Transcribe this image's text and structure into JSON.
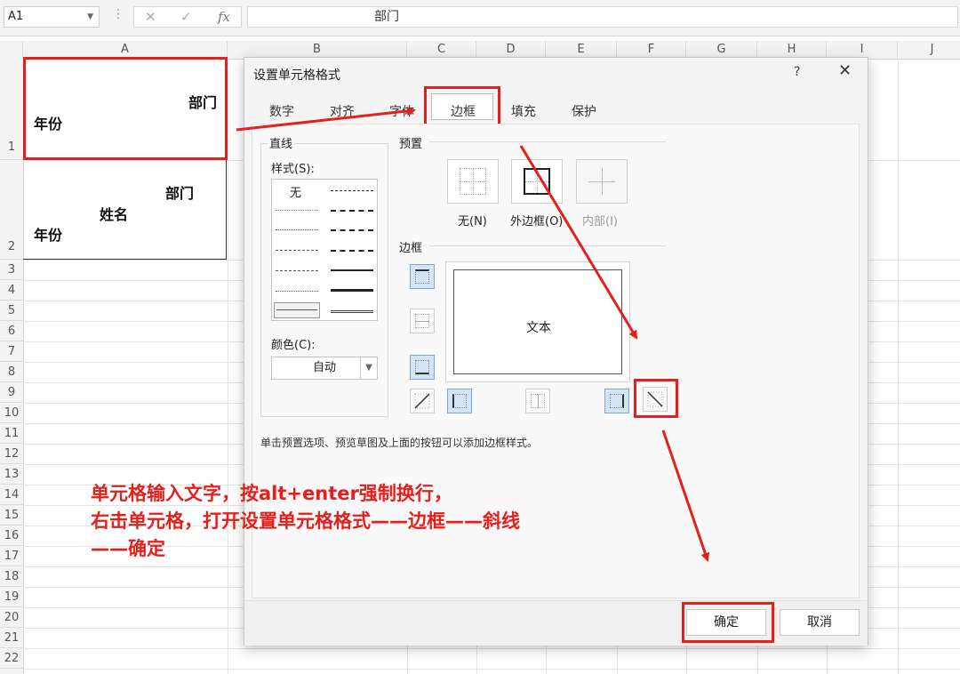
{
  "formula_bar": {
    "name_box": "A1",
    "formula": "部门",
    "cancel_icon": "✕",
    "enter_icon": "✓",
    "fx_icon": "fx"
  },
  "grid": {
    "columns": [
      "A",
      "B",
      "C",
      "D",
      "E",
      "F",
      "G",
      "H",
      "I",
      "J"
    ],
    "rows": [
      "1",
      "2",
      "3",
      "4",
      "5",
      "6",
      "7",
      "8",
      "9",
      "10",
      "11",
      "12",
      "13",
      "14",
      "15",
      "16",
      "17",
      "18",
      "19",
      "20",
      "21",
      "22"
    ],
    "a1": {
      "line1": "部门",
      "line2": "年份"
    },
    "a2": {
      "line1": "部门",
      "line2": "姓名",
      "line3": "年份"
    }
  },
  "dialog": {
    "title": "设置单元格格式",
    "help": "?",
    "close": "✕",
    "tabs": [
      "数字",
      "对齐",
      "字体",
      "边框",
      "填充",
      "保护"
    ],
    "active_tab": "边框",
    "line": {
      "group_label": "直线",
      "style_label": "样式(S):",
      "none_label": "无",
      "color_label": "颜色(C):",
      "color_value": "自动"
    },
    "presets": {
      "label": "预置",
      "none": "无(N)",
      "outline": "外边框(O)",
      "inside": "内部(I)"
    },
    "border": {
      "label": "边框",
      "preview_text": "文本"
    },
    "hint": "单击预置选项、预览草图及上面的按钮可以添加边框样式。",
    "ok": "确定",
    "cancel": "取消"
  },
  "annotation": {
    "line1": "单元格输入文字，按alt+enter强制换行，",
    "line2": "右击单元格，打开设置单元格格式——边框——斜线",
    "line3": "——确定"
  },
  "colors": {
    "accent_red": "#e3201b",
    "selected_button": "#d3e4f5"
  }
}
